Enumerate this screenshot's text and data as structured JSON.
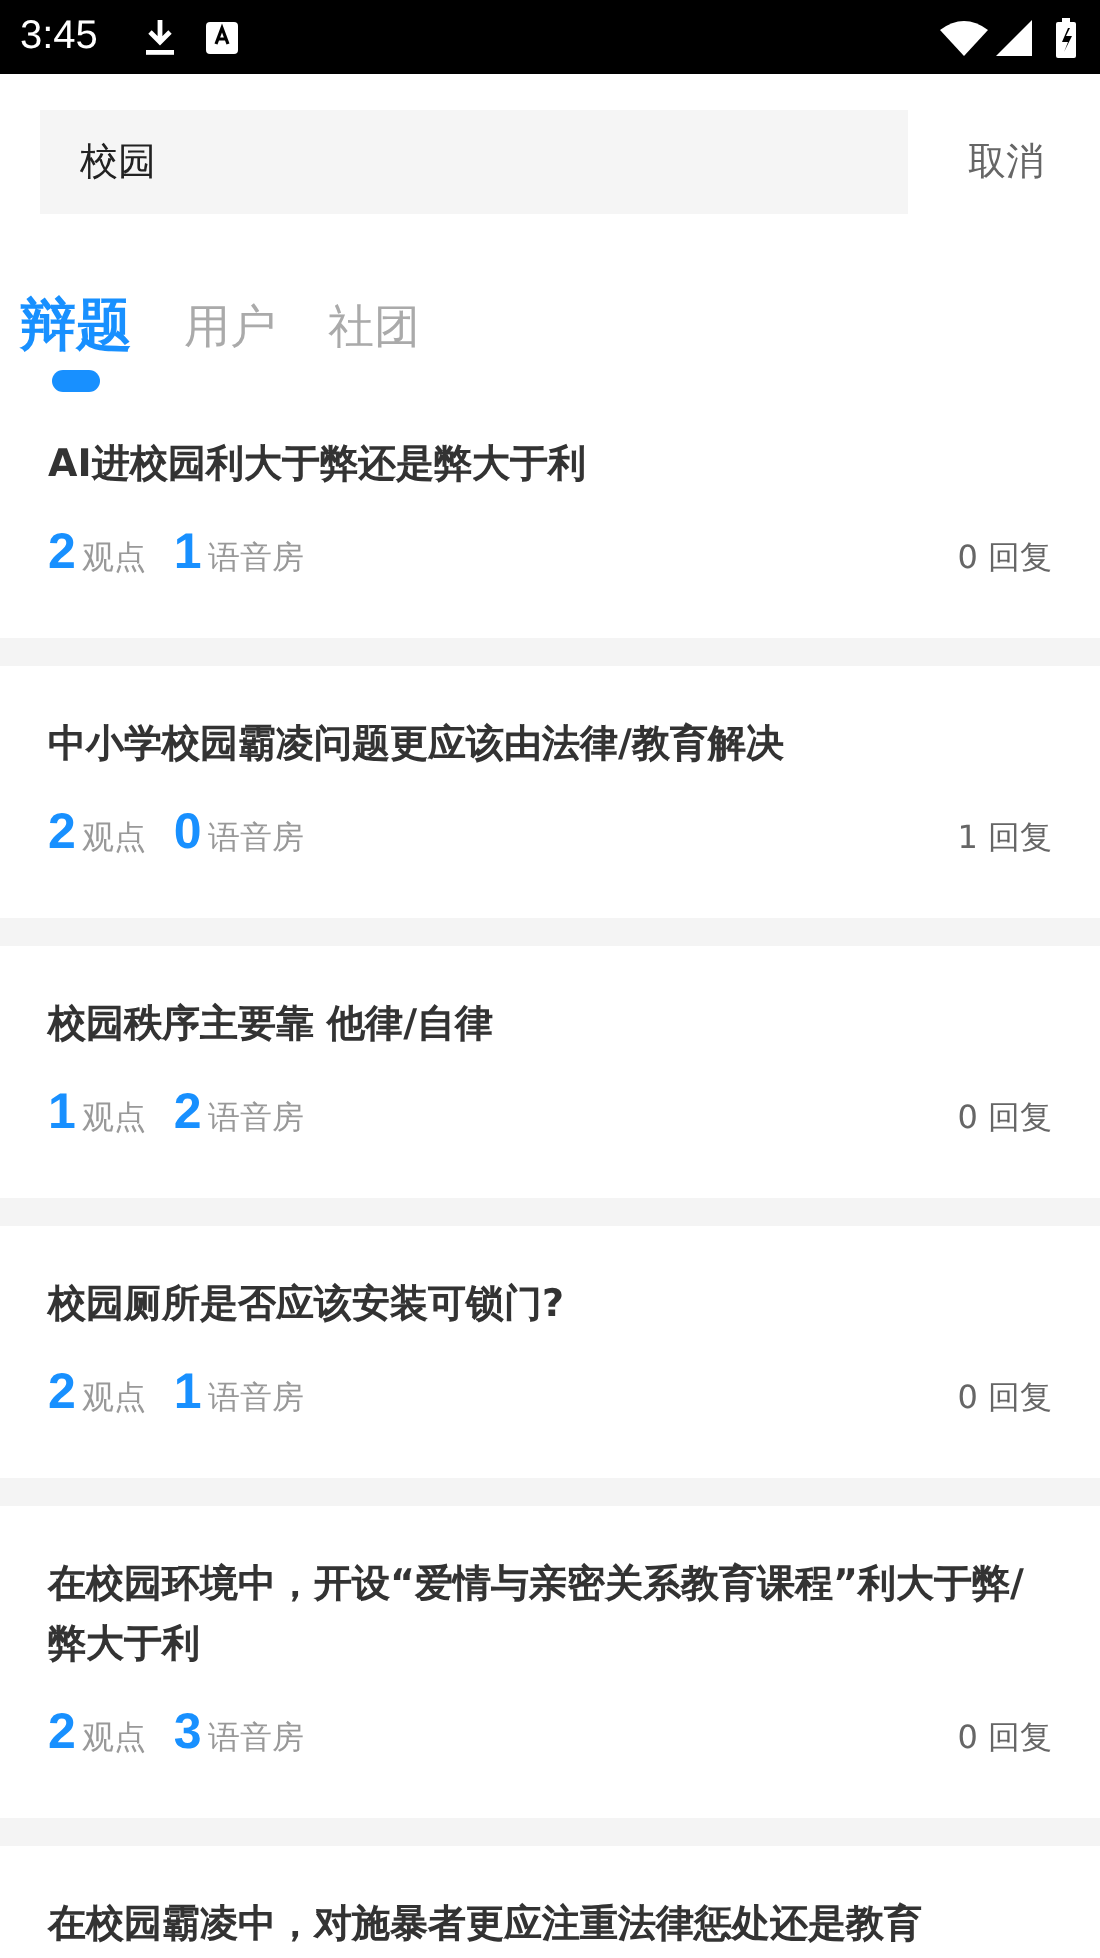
{
  "status_bar": {
    "time": "3:45"
  },
  "search": {
    "value": "校园",
    "cancel": "取消"
  },
  "tabs": [
    {
      "label": "辩题",
      "selected": true
    },
    {
      "label": "用户",
      "selected": false
    },
    {
      "label": "社团",
      "selected": false
    }
  ],
  "topics": [
    {
      "title": "AI进校园利大于弊还是弊大于利",
      "views": "2",
      "views_label": "观点",
      "rooms": "1",
      "rooms_label": "语音房",
      "replies": "0 回复"
    },
    {
      "title": "中小学校园霸凌问题更应该由法律/教育解决",
      "views": "2",
      "views_label": "观点",
      "rooms": "0",
      "rooms_label": "语音房",
      "replies": "1 回复"
    },
    {
      "title": "校园秩序主要靠  他律/自律",
      "views": "1",
      "views_label": "观点",
      "rooms": "2",
      "rooms_label": "语音房",
      "replies": "0 回复"
    },
    {
      "title": "校园厕所是否应该安装可锁门?",
      "views": "2",
      "views_label": "观点",
      "rooms": "1",
      "rooms_label": "语音房",
      "replies": "0 回复"
    },
    {
      "title": "在校园环境中，开设“爱情与亲密关系教育课程”利大于弊/弊大于利",
      "views": "2",
      "views_label": "观点",
      "rooms": "3",
      "rooms_label": "语音房",
      "replies": "0 回复"
    },
    {
      "title": "在校园霸凌中，对施暴者更应注重法律惩处还是教育"
    }
  ]
}
